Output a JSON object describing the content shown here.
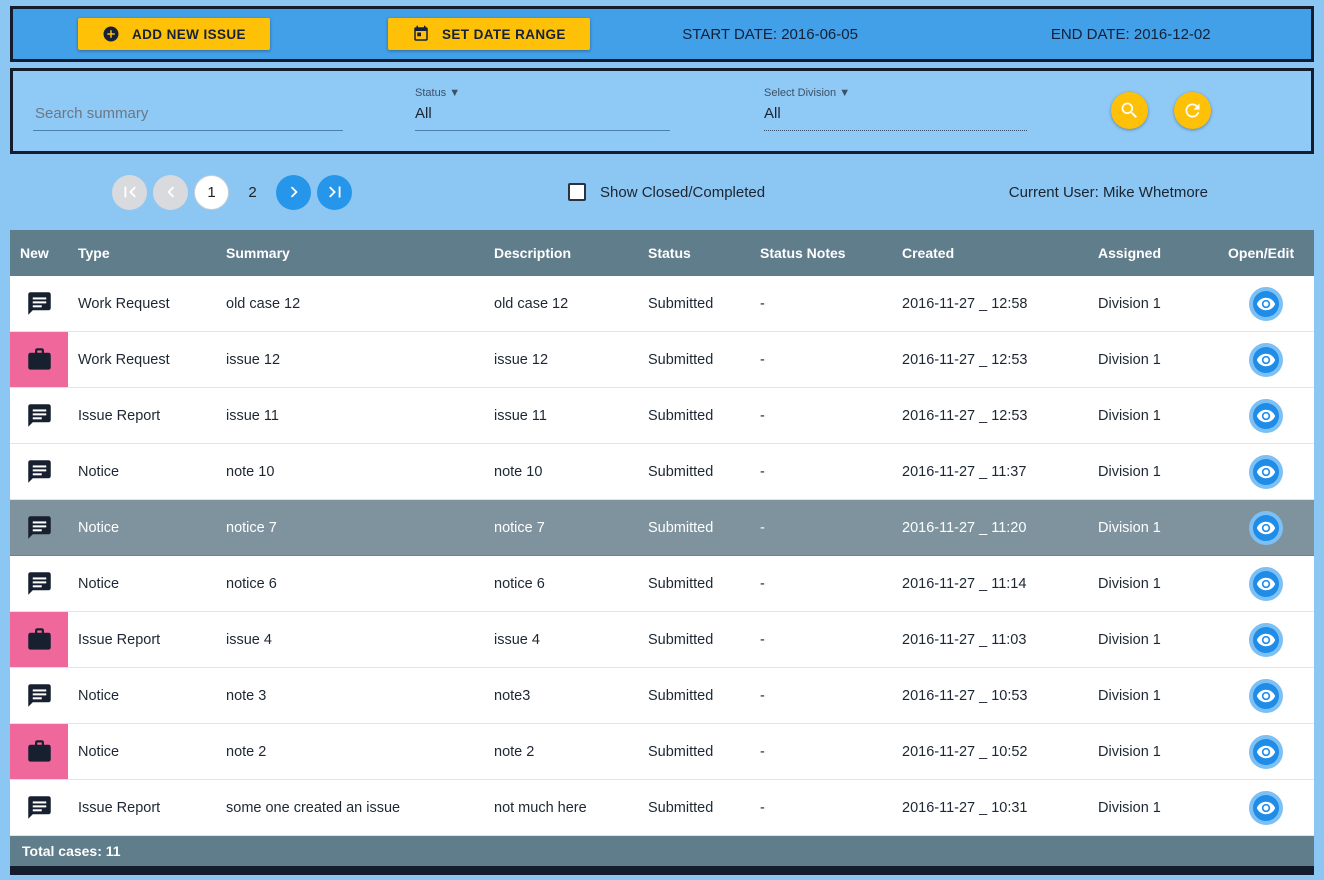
{
  "colors": {
    "accent_yellow": "#FFC107",
    "topbar_blue": "#42A0E8",
    "page_blue": "#8CC6F2",
    "slate_header": "#607D8B",
    "selected_row": "#7E939E",
    "new_pink": "#F0689B",
    "eye_button_blue": "#1E88E5",
    "dark_navy": "#141C2E"
  },
  "topbar": {
    "add_new_issue": "ADD NEW ISSUE",
    "set_date_range": "SET DATE RANGE",
    "start_date": "START DATE: 2016-06-05",
    "end_date": "END DATE: 2016-12-02"
  },
  "filters": {
    "search_placeholder": "Search summary",
    "status_label": "Status ▼",
    "status_value": "All",
    "division_label": "Select Division ▼",
    "division_value": "All",
    "search_button_icon": "search-icon",
    "refresh_button_icon": "refresh-icon"
  },
  "pagination": {
    "pages": [
      "1",
      "2"
    ],
    "active_page": "1",
    "icons": [
      "first-page-icon",
      "prev-page-icon",
      "next-page-icon",
      "last-page-icon"
    ]
  },
  "toolbar": {
    "show_closed_label": "Show Closed/Completed",
    "show_closed_checked": false,
    "current_user": "Current User: Mike Whetmore"
  },
  "table": {
    "headers": [
      "New",
      "Type",
      "Summary",
      "Description",
      "Status",
      "Status Notes",
      "Created",
      "Assigned",
      "Open/Edit"
    ],
    "rows": [
      {
        "icon": "chat-icon",
        "new_highlight": false,
        "type": "Work Request",
        "summary": "old case 12",
        "description": "old case 12",
        "status": "Submitted",
        "status_notes": "-",
        "created": "2016-11-27 _ 12:58",
        "assigned": "Division 1",
        "selected": false
      },
      {
        "icon": "briefcase-icon",
        "new_highlight": true,
        "type": "Work Request",
        "summary": "issue 12",
        "description": "issue 12",
        "status": "Submitted",
        "status_notes": "-",
        "created": "2016-11-27 _ 12:53",
        "assigned": "Division 1",
        "selected": false
      },
      {
        "icon": "chat-icon",
        "new_highlight": false,
        "type": "Issue Report",
        "summary": "issue 11",
        "description": "issue 11",
        "status": "Submitted",
        "status_notes": "-",
        "created": "2016-11-27 _ 12:53",
        "assigned": "Division 1",
        "selected": false
      },
      {
        "icon": "chat-icon",
        "new_highlight": false,
        "type": "Notice",
        "summary": "note 10",
        "description": "note 10",
        "status": "Submitted",
        "status_notes": "-",
        "created": "2016-11-27 _ 11:37",
        "assigned": "Division 1",
        "selected": false
      },
      {
        "icon": "chat-icon",
        "new_highlight": false,
        "type": "Notice",
        "summary": "notice 7",
        "description": "notice 7",
        "status": "Submitted",
        "status_notes": "-",
        "created": "2016-11-27 _ 11:20",
        "assigned": "Division 1",
        "selected": true
      },
      {
        "icon": "chat-icon",
        "new_highlight": false,
        "type": "Notice",
        "summary": "notice 6",
        "description": "notice 6",
        "status": "Submitted",
        "status_notes": "-",
        "created": "2016-11-27 _ 11:14",
        "assigned": "Division 1",
        "selected": false
      },
      {
        "icon": "briefcase-icon",
        "new_highlight": true,
        "type": "Issue Report",
        "summary": "issue 4",
        "description": "issue 4",
        "status": "Submitted",
        "status_notes": "-",
        "created": "2016-11-27 _ 11:03",
        "assigned": "Division 1",
        "selected": false
      },
      {
        "icon": "chat-icon",
        "new_highlight": false,
        "type": "Notice",
        "summary": "note 3",
        "description": "note3",
        "status": "Submitted",
        "status_notes": "-",
        "created": "2016-11-27 _ 10:53",
        "assigned": "Division 1",
        "selected": false
      },
      {
        "icon": "briefcase-icon",
        "new_highlight": true,
        "type": "Notice",
        "summary": "note 2",
        "description": "note 2",
        "status": "Submitted",
        "status_notes": "-",
        "created": "2016-11-27 _ 10:52",
        "assigned": "Division 1",
        "selected": false
      },
      {
        "icon": "chat-icon",
        "new_highlight": false,
        "type": "Issue Report",
        "summary": "some one created an issue",
        "description": "not much here",
        "status": "Submitted",
        "status_notes": "-",
        "created": "2016-11-27 _ 10:31",
        "assigned": "Division 1",
        "selected": false
      }
    ],
    "footer": "Total cases: 11"
  }
}
